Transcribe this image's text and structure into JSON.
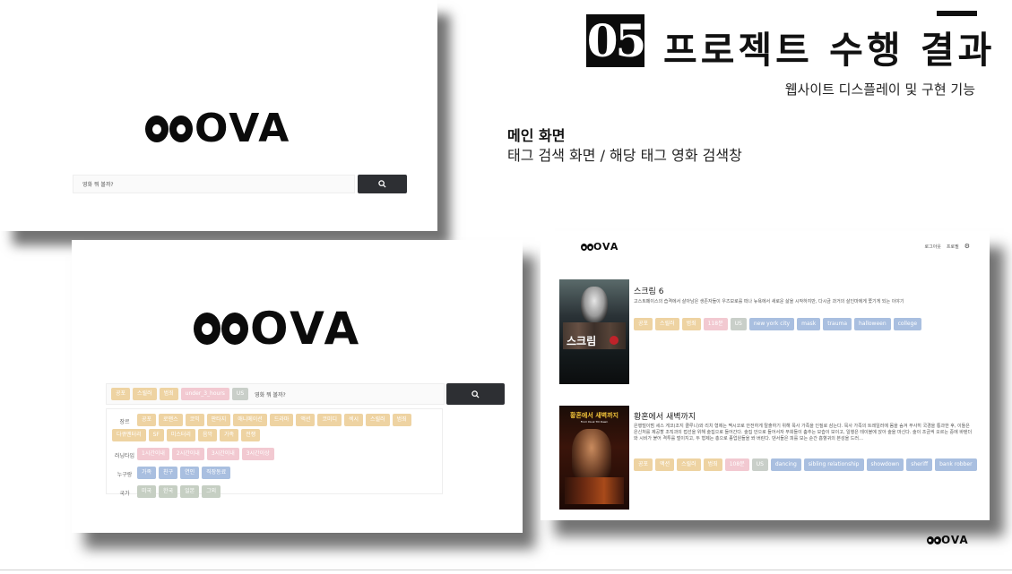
{
  "header": {
    "section_number": "05",
    "section_title": "프로젝트 수행 결과",
    "section_subtitle": "웹사이트 디스플레이 및 구현 기능",
    "desc_title": "메인 화면",
    "desc_text": "태그 검색 화면 / 해당 태그 영화 검색창"
  },
  "brand": {
    "logo_text": "MEOVA",
    "logo_letters": "OVA"
  },
  "panel_main": {
    "search_placeholder": "영화 뭐 볼까?"
  },
  "panel_tags": {
    "selected_tags": [
      {
        "label": "공포",
        "color": "gold"
      },
      {
        "label": "스릴러",
        "color": "gold"
      },
      {
        "label": "범죄",
        "color": "gold"
      },
      {
        "label": "under_3_hours",
        "color": "pink"
      },
      {
        "label": "US",
        "color": "grey"
      }
    ],
    "search_placeholder": "영화 뭐 볼까?",
    "filters": {
      "genre_label": "장르",
      "genres": [
        "공포",
        "로맨스",
        "코믹",
        "판타지",
        "애니메이션",
        "드라마",
        "액션",
        "코미디",
        "섹시",
        "스릴러",
        "범죄",
        "다큐멘터리",
        "SF",
        "미스터리",
        "음악",
        "가족",
        "전쟁"
      ],
      "runtime_label": "러닝타임",
      "runtimes": [
        "1시간이내",
        "2시간이내",
        "3시간이내",
        "3시간이상"
      ],
      "who_label": "누구랑",
      "who": [
        "가족",
        "친구",
        "연인",
        "직장동료"
      ],
      "country_label": "국가",
      "countries": [
        "미국",
        "한국",
        "일본",
        "그외"
      ]
    }
  },
  "panel_results": {
    "nav": {
      "logout": "로그아웃",
      "profile": "프로필"
    },
    "movies": [
      {
        "title": "스크림 6",
        "description": "고스트페이스의 습격에서 살아남은 생존자들이 우즈보로를 떠나 뉴욕에서 새로운 삶을 시작하지만, 다시금 과거의 살인마에게 쫓기게 되는 이야기",
        "poster_text": "스크림",
        "tags": [
          {
            "label": "공포",
            "color": "gold"
          },
          {
            "label": "스릴러",
            "color": "gold"
          },
          {
            "label": "범죄",
            "color": "gold"
          },
          {
            "label": "118분",
            "color": "pink"
          },
          {
            "label": "US",
            "color": "grey"
          },
          {
            "label": "new york city",
            "color": "blue"
          },
          {
            "label": "mask",
            "color": "blue"
          },
          {
            "label": "trauma",
            "color": "blue"
          },
          {
            "label": "halloween",
            "color": "blue"
          },
          {
            "label": "college",
            "color": "blue"
          }
        ]
      },
      {
        "title": "황혼에서 새벽까지",
        "description": "은행털이범 세스 게코(조지 클루니)와 리치 형제는 멕시코로 안전하게 탈출하기 위해 목사 가족을 인질로 삼는다. 목사 가족의 트레일러에 몸을 숨겨 무사히 국경을 통과한 후, 이들은 은신처를 제공할 조직과의 접선을 위해 술집으로 들어간다. 술집 안으로 들어서자 무희들이 춤추는 모습이 보이고, 일행은 테이블에 앉아 술을 마신다. 술이 조금씩 오르는 중에 바텐더와 시비가 붙어 격투를 벌이지고, 두 형제는 총으로 종업원들을 쏴 버린다. 댄서들은 피를 보는 순간 흡혈귀의 본성을 드러…",
        "poster_text": "황혼에서 새벽까지",
        "poster_subtext": "From Dusk Till Dawn",
        "tags": [
          {
            "label": "공포",
            "color": "gold"
          },
          {
            "label": "액션",
            "color": "gold"
          },
          {
            "label": "스릴러",
            "color": "gold"
          },
          {
            "label": "범죄",
            "color": "gold"
          },
          {
            "label": "108분",
            "color": "pink"
          },
          {
            "label": "US",
            "color": "grey"
          },
          {
            "label": "dancing",
            "color": "blue"
          },
          {
            "label": "sibling relationship",
            "color": "blue"
          },
          {
            "label": "showdown",
            "color": "blue"
          },
          {
            "label": "sheriff",
            "color": "blue"
          },
          {
            "label": "bank robber",
            "color": "blue"
          }
        ]
      }
    ]
  },
  "footer": {
    "logo_text": "MEOVA"
  },
  "colors": {
    "gold_tag": "#eed3a2",
    "pink_tag": "#f2c9d1",
    "grey_tag": "#c9cfc9",
    "blue_tag": "#a9bfe0",
    "button_dark": "#2d2f33"
  }
}
